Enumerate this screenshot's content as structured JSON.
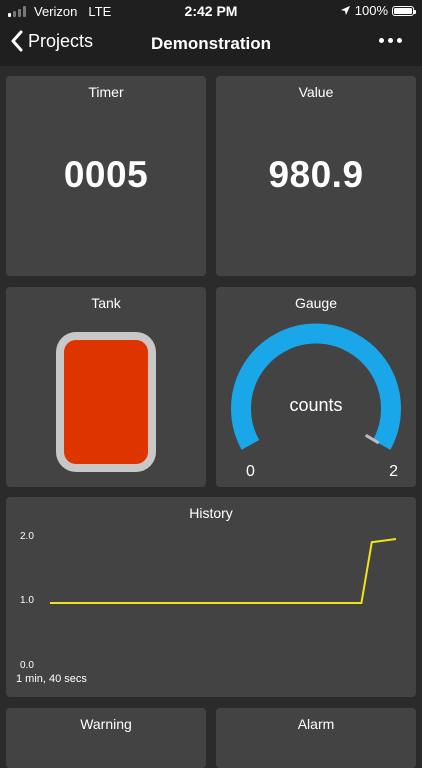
{
  "status_bar": {
    "carrier": "Verizon",
    "network": "LTE",
    "time": "2:42 PM",
    "battery": "100%",
    "icons": [
      "signal-icon",
      "location-arrow-icon",
      "battery-icon"
    ]
  },
  "nav": {
    "back_label": "Projects",
    "title": "Demonstration",
    "more_icon": "ellipsis-icon"
  },
  "widgets": {
    "timer": {
      "title": "Timer",
      "value": "0005"
    },
    "value": {
      "title": "Value",
      "value": "980.9"
    },
    "tank": {
      "title": "Tank",
      "fill_color": "#de3400",
      "frame_color": "#c8c8c8"
    },
    "gauge": {
      "title": "Gauge",
      "units": "counts",
      "min": "0",
      "max": "2",
      "level": 2,
      "range": [
        0,
        2
      ],
      "arc_color": "#1aa7ea"
    },
    "history": {
      "title": "History",
      "y_ticks": [
        "2.0",
        "1.0",
        "0.0"
      ],
      "duration": "1 min, 40 secs",
      "line_color": "#f2e21b"
    },
    "warning": {
      "title": "Warning"
    },
    "alarm": {
      "title": "Alarm"
    }
  },
  "chart_data": {
    "type": "line",
    "title": "History",
    "x": [
      0,
      85,
      90,
      93,
      100
    ],
    "series": [
      {
        "values": [
          1.0,
          1.0,
          1.0,
          1.95,
          2.0
        ]
      }
    ],
    "ylim": [
      0,
      2
    ],
    "y_ticks": [
      0.0,
      1.0,
      2.0
    ],
    "xlabel": "1 min, 40 secs",
    "grid": false
  }
}
